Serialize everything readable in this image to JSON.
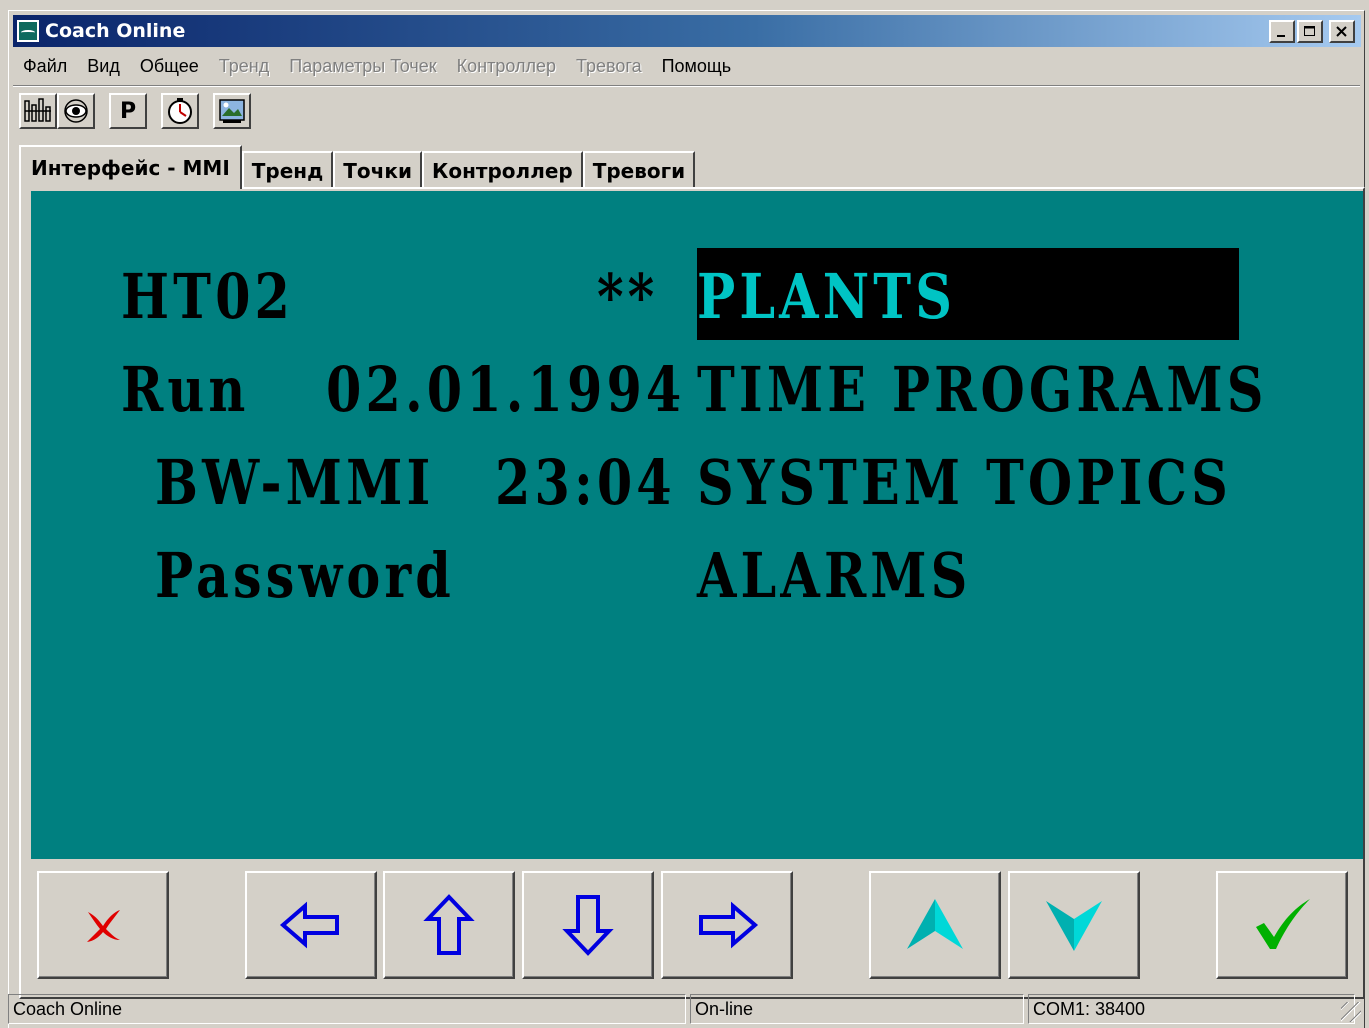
{
  "window": {
    "title": "Coach Online",
    "controls": {
      "minimize": "_",
      "maximize": "□",
      "close": "✕"
    }
  },
  "menu": [
    {
      "label": "Файл",
      "enabled": true
    },
    {
      "label": "Вид",
      "enabled": true
    },
    {
      "label": "Общее",
      "enabled": true
    },
    {
      "label": "Тренд",
      "enabled": false
    },
    {
      "label": "Параметры Точек",
      "enabled": false
    },
    {
      "label": "Контроллер",
      "enabled": false
    },
    {
      "label": "Тревога",
      "enabled": false
    },
    {
      "label": "Помощь",
      "enabled": true
    }
  ],
  "toolbar": {
    "buttons": [
      {
        "icon": "connect-icon"
      },
      {
        "icon": "eye-icon"
      },
      {
        "icon": "parameters-icon",
        "label": "P"
      },
      {
        "icon": "clock-icon"
      },
      {
        "icon": "picture-icon"
      }
    ]
  },
  "tabs": [
    {
      "label": "Интерфейс - MMI",
      "active": true
    },
    {
      "label": "Тренд",
      "active": false
    },
    {
      "label": "Точки",
      "active": false
    },
    {
      "label": "Контроллер",
      "active": false
    },
    {
      "label": "Тревоги",
      "active": false
    }
  ],
  "mmi": {
    "device": "HT02",
    "marker": "**",
    "mode": "Run",
    "date": "02.01.1994",
    "unit": "BW-MMI",
    "time": "23:04",
    "password_label": "Password",
    "menu_items": [
      "PLANTS",
      "TIME PROGRAMS",
      "SYSTEM TOPICS",
      "ALARMS"
    ],
    "selected_item": "PLANTS",
    "colors": {
      "background": "#008080",
      "text": "#000000",
      "highlight_bg": "#000000",
      "highlight_text": "#00c4c4"
    }
  },
  "keys": [
    {
      "icon": "cancel-x-icon",
      "color": "#e00000"
    },
    {
      "icon": "arrow-left-icon",
      "color": "#0000e0"
    },
    {
      "icon": "arrow-up-icon",
      "color": "#0000e0"
    },
    {
      "icon": "arrow-down-icon",
      "color": "#0000e0"
    },
    {
      "icon": "arrow-right-icon",
      "color": "#0000e0"
    },
    {
      "icon": "increase-icon",
      "color": "#00d8d8"
    },
    {
      "icon": "decrease-icon",
      "color": "#00d8d8"
    },
    {
      "icon": "confirm-check-icon",
      "color": "#00b000"
    }
  ],
  "status": {
    "app": "Coach Online",
    "connection": "On-line",
    "port": "COM1: 38400"
  }
}
